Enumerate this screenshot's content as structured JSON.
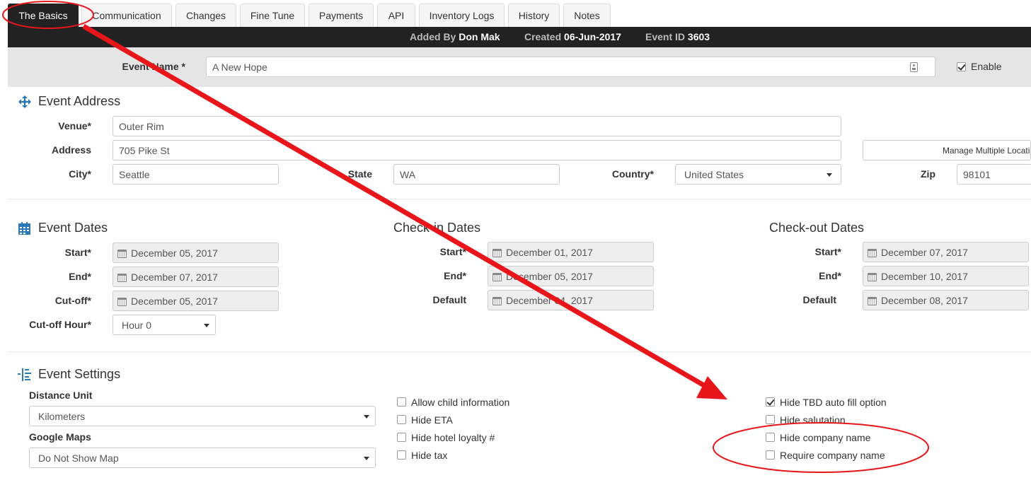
{
  "tabs": [
    "The Basics",
    "Communication",
    "Changes",
    "Fine Tune",
    "Payments",
    "API",
    "Inventory Logs",
    "History",
    "Notes"
  ],
  "info": {
    "added_by_label": "Added By",
    "added_by_value": "Don Mak",
    "created_label": "Created",
    "created_value": "06-Jun-2017",
    "event_id_label": "Event ID",
    "event_id_value": "3603"
  },
  "event_name": {
    "label": "Event Name *",
    "value": "A New Hope",
    "enable_label": "Enable",
    "enable_checked": true
  },
  "address": {
    "title": "Event Address",
    "venue_label": "Venue*",
    "venue_value": "Outer Rim",
    "address_label": "Address",
    "address_value": "705 Pike St",
    "city_label": "City*",
    "city_value": "Seattle",
    "state_label": "State",
    "state_value": "WA",
    "country_label": "Country*",
    "country_value": "United States",
    "zip_label": "Zip",
    "zip_value": "98101",
    "manage_button": "Manage Multiple Locatio"
  },
  "event_dates": {
    "title": "Event Dates",
    "start_label": "Start*",
    "start_value": "December 05, 2017",
    "end_label": "End*",
    "end_value": "December 07, 2017",
    "cutoff_label": "Cut-off*",
    "cutoff_value": "December 05, 2017",
    "cutoff_hour_label": "Cut-off Hour*",
    "cutoff_hour_value": "Hour 0"
  },
  "checkin_dates": {
    "title": "Check-in Dates",
    "start_label": "Start*",
    "start_value": "December 01, 2017",
    "end_label": "End*",
    "end_value": "December 05, 2017",
    "default_label": "Default",
    "default_value": "December 04, 2017"
  },
  "checkout_dates": {
    "title": "Check-out Dates",
    "start_label": "Start*",
    "start_value": "December 07, 2017",
    "end_label": "End*",
    "end_value": "December 10, 2017",
    "default_label": "Default",
    "default_value": "December 08, 2017"
  },
  "settings": {
    "title": "Event Settings",
    "distance_unit_label": "Distance Unit",
    "distance_unit_value": "Kilometers",
    "google_maps_label": "Google Maps",
    "google_maps_value": "Do Not Show Map",
    "col1": [
      {
        "label": "Allow child information",
        "checked": false
      },
      {
        "label": "Hide ETA",
        "checked": false
      },
      {
        "label": "Hide hotel loyalty #",
        "checked": false
      },
      {
        "label": "Hide tax",
        "checked": false
      }
    ],
    "col2": [
      {
        "label": "Hide TBD auto fill option",
        "checked": true
      },
      {
        "label": "Hide salutation",
        "checked": false
      },
      {
        "label": "Hide company name",
        "checked": false
      },
      {
        "label": "Require company name",
        "checked": false
      }
    ]
  },
  "annotation_color": "#e8161b",
  "accent_color": "#2a7ab8"
}
